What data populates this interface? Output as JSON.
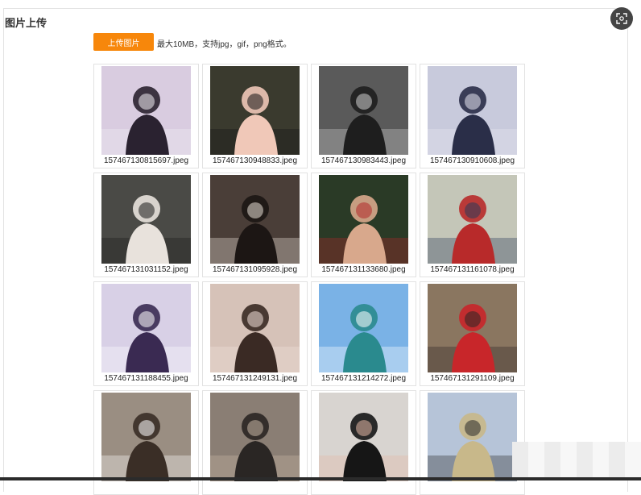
{
  "page_title": "图片上传",
  "upload": {
    "button_label": "上传图片",
    "hint": "最大10MB，支持jpg，gif，png格式。"
  },
  "expand_icon": "fullscreen-icon",
  "images": [
    {
      "filename": "157467130815697.jpeg",
      "bg": "#d9cce0",
      "fg": "#2a2230",
      "accent": "#f2eef4"
    },
    {
      "filename": "157467130948833.jpeg",
      "bg": "#3a3a2e",
      "fg": "#f0c8b8",
      "accent": "#141414"
    },
    {
      "filename": "157467130983443.jpeg",
      "bg": "#5a5a5a",
      "fg": "#1e1e1e",
      "accent": "#cfcfcf"
    },
    {
      "filename": "157467130910608.jpeg",
      "bg": "#c8cadc",
      "fg": "#2a2e48",
      "accent": "#e8e8f2"
    },
    {
      "filename": "157467131031152.jpeg",
      "bg": "#4a4a46",
      "fg": "#e8e2dc",
      "accent": "#1a1a1a"
    },
    {
      "filename": "157467131095928.jpeg",
      "bg": "#4a3e38",
      "fg": "#1c1614",
      "accent": "#e8e0d6"
    },
    {
      "filename": "157467131133680.jpeg",
      "bg": "#2a3a26",
      "fg": "#d8a88c",
      "accent": "#b0282a"
    },
    {
      "filename": "157467131161078.jpeg",
      "bg": "#c4c6b8",
      "fg": "#b82a2a",
      "accent": "#2a3a5a"
    },
    {
      "filename": "157467131188455.jpeg",
      "bg": "#d8d0e6",
      "fg": "#3a2a52",
      "accent": "#ffffff"
    },
    {
      "filename": "157467131249131.jpeg",
      "bg": "#d6c2b8",
      "fg": "#3a2a24",
      "accent": "#f2e2da"
    },
    {
      "filename": "157467131214272.jpeg",
      "bg": "#7ab2e6",
      "fg": "#2a8a8e",
      "accent": "#ffffff"
    },
    {
      "filename": "157467131291109.jpeg",
      "bg": "#8a7660",
      "fg": "#c8262a",
      "accent": "#2a2624"
    },
    {
      "filename": "",
      "bg": "#9a8e82",
      "fg": "#3a2e26",
      "accent": "#ffffff"
    },
    {
      "filename": "",
      "bg": "#8a7e74",
      "fg": "#2a2624",
      "accent": "#c8b8a6"
    },
    {
      "filename": "",
      "bg": "#d8d4d0",
      "fg": "#161616",
      "accent": "#e4b8a6"
    },
    {
      "filename": "",
      "bg": "#b6c4d8",
      "fg": "#c8b88a",
      "accent": "#2a2a2a"
    }
  ]
}
